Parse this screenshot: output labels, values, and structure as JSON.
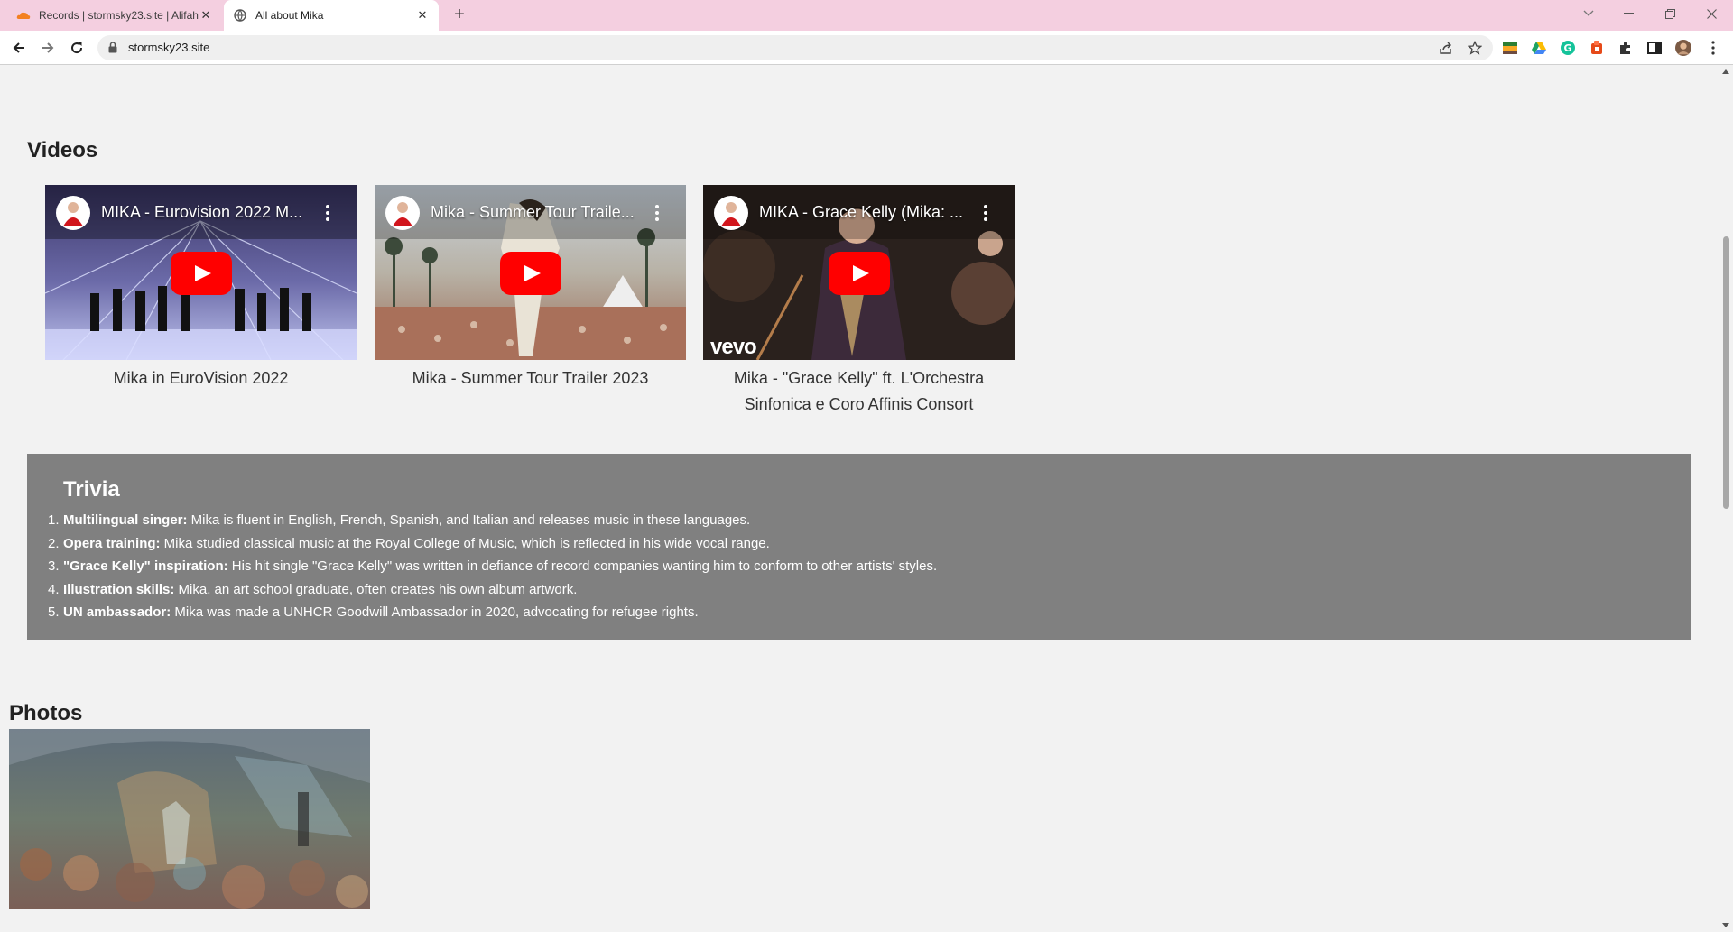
{
  "browser": {
    "tabs": [
      {
        "title": "Records | stormsky23.site | Alifah",
        "favicon": "cloud-icon",
        "active": false
      },
      {
        "title": "All about Mika",
        "favicon": "globe-icon",
        "active": true
      }
    ],
    "new_tab_label": "+",
    "url": "stormsky23.site",
    "window_controls": [
      "chevron-down-icon",
      "minimize-icon",
      "restore-icon",
      "close-icon"
    ]
  },
  "videos": {
    "heading": "Videos",
    "items": [
      {
        "thumb_title": "MIKA - Eurovision 2022 M...",
        "caption": "Mika in EuroVision 2022",
        "vevo": ""
      },
      {
        "thumb_title": "Mika - Summer Tour Traile...",
        "caption": "Mika - Summer Tour Trailer 2023",
        "vevo": ""
      },
      {
        "thumb_title": "MIKA - Grace Kelly (Mika: ...",
        "caption": "Mika - \"Grace Kelly\" ft. L'Orchestra Sinfonica e Coro Affinis Consort",
        "vevo": "vevo"
      }
    ]
  },
  "trivia": {
    "heading": "Trivia",
    "items": [
      {
        "num": "1.",
        "label": "Multilingual singer:",
        "text": " Mika is fluent in English, French, Spanish, and Italian and releases music in these languages."
      },
      {
        "num": "2.",
        "label": "Opera training:",
        "text": " Mika studied classical music at the Royal College of Music, which is reflected in his wide vocal range."
      },
      {
        "num": "3.",
        "label": "\"Grace Kelly\" inspiration:",
        "text": " His hit single \"Grace Kelly\" was written in defiance of record companies wanting him to conform to other artists' styles."
      },
      {
        "num": "4.",
        "label": "Illustration skills:",
        "text": " Mika, an art school graduate, often creates his own album artwork."
      },
      {
        "num": "5.",
        "label": "UN ambassador:",
        "text": " Mika was made a UNHCR Goodwill Ambassador in 2020, advocating for refugee rights."
      }
    ]
  },
  "photos": {
    "heading": "Photos"
  },
  "colors": {
    "tabbar": "#f4cfe0",
    "trivia_bg": "#808080",
    "youtube_red": "#ff0000"
  }
}
